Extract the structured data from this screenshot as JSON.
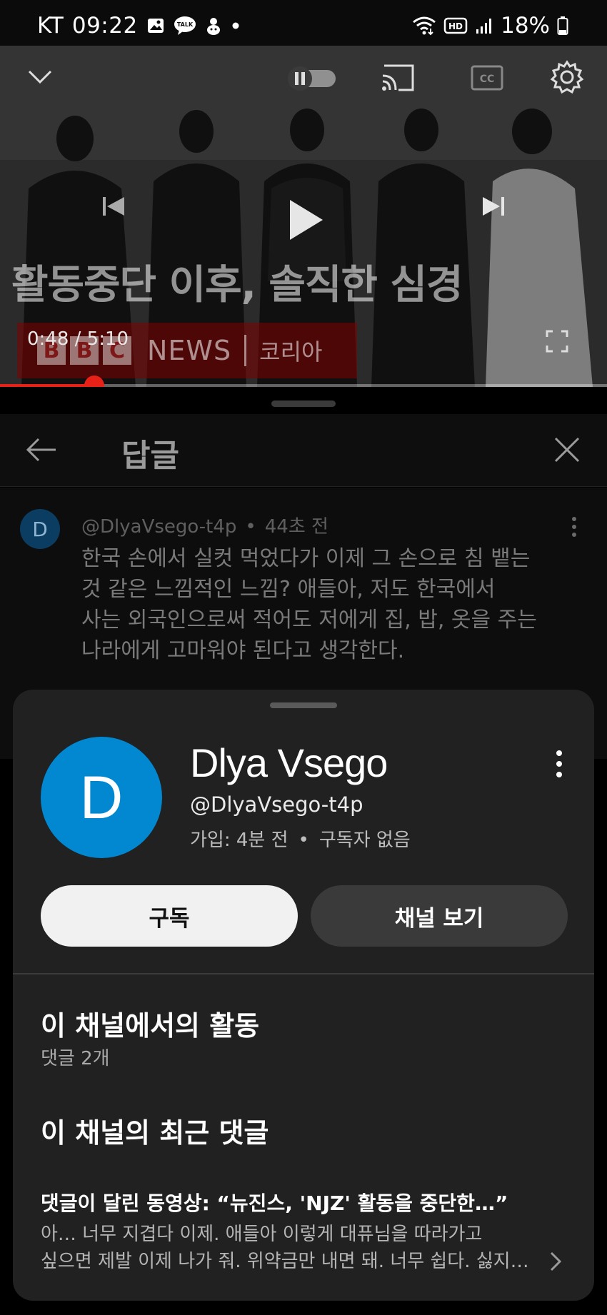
{
  "status_bar": {
    "carrier": "KT",
    "time": "09:22",
    "battery": "18%"
  },
  "video": {
    "caption": "활동중단 이후, 솔직한 심경",
    "bbc_letters": [
      "B",
      "B",
      "C"
    ],
    "news_label": "NEWS",
    "korea_label": "코리아",
    "time_display": "0:48 / 5:10",
    "progress": 0.155
  },
  "replies": {
    "title": "답글"
  },
  "comment": {
    "avatar_letter": "D",
    "author": "@DlyaVsego-t4p",
    "age": "44초 전",
    "lines": [
      "한국 손에서 실컷 먹었다가 이제 그 손으로 침 뱉는",
      "것 같은 느낌적인 느낌? 애들아, 저도 한국에서",
      "사는 외국인으로써 적어도 저에게 집, 밥, 옷을 주는",
      "나라에게 고마워야 된다고 생각한다."
    ]
  },
  "channel": {
    "avatar_letter": "D",
    "name": "Dlya Vsego",
    "handle": "@DlyaVsego-t4p",
    "joined": "가입: 4분 전",
    "subscribers": "구독자 없음",
    "subscribe_label": "구독",
    "view_channel_label": "채널 보기",
    "activity_title": "이 채널에서의 활동",
    "activity_sub": "댓글 2개",
    "recent_title": "이 채널의 최근 댓글",
    "recent_video": "댓글이 달린 동영상: “뉴진스, 'NJZ' 활동을 중단한…”",
    "recent_lines": [
      "아… 너무 지겹다 이제. 애들아 이렇게 대퓨님을 따라가고",
      "싶으면 제발 이제 나가 줘. 위약금만 내면 돼. 너무 쉽다. 싫지…"
    ]
  },
  "colors": {
    "progress": "#e62117",
    "channel_avatar": "#0288d1",
    "sheet_bg": "#212121"
  }
}
